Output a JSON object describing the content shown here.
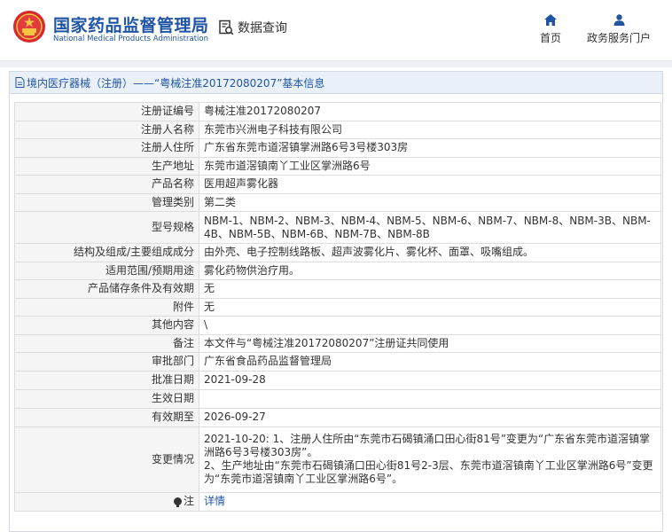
{
  "header": {
    "brand_cn": "国家药品监督管理局",
    "brand_en": "National Medical Products Administration",
    "query_label": "数据查询",
    "nav": [
      {
        "label": "首页",
        "icon": "home-icon"
      },
      {
        "label": "政务服务门户",
        "icon": "user-icon"
      }
    ]
  },
  "panel": {
    "title": "境内医疗器械（注册）——“粤械注准20172080207”基本信息"
  },
  "record": {
    "reg_no": {
      "label": "注册证编号",
      "value": "粤械注准20172080207"
    },
    "registrant": {
      "label": "注册人名称",
      "value": "东莞市兴洲电子科技有限公司"
    },
    "address": {
      "label": "注册人住所",
      "value": "广东省东莞市道滘镇掌洲路6号3号楼303房"
    },
    "prod_addr": {
      "label": "生产地址",
      "value": "东莞市道滘镇南丫工业区掌洲路6号"
    },
    "product": {
      "label": "产品名称",
      "value": "医用超声雾化器"
    },
    "category": {
      "label": "管理类别",
      "value": "第二类"
    },
    "models": {
      "label": "型号规格",
      "value": "NBM-1、NBM-2、NBM-3、NBM-4、NBM-5、NBM-6、NBM-7、NBM-8、NBM-3B、NBM-4B、NBM-5B、NBM-6B、NBM-7B、NBM-8B"
    },
    "structure": {
      "label": "结构及组成/主要组成成分",
      "value": "由外壳、电子控制线路板、超声波雾化片、雾化杯、面罩、吸嘴组成。"
    },
    "scope": {
      "label": "适用范围/预期用途",
      "value": "雾化药物供治疗用。"
    },
    "storage": {
      "label": "产品储存条件及有效期",
      "value": "无"
    },
    "attachment": {
      "label": "附件",
      "value": "无"
    },
    "other": {
      "label": "其他内容",
      "value": "\\"
    },
    "remark": {
      "label": "备注",
      "value": "本文件与“粤械注准20172080207”注册证共同使用"
    },
    "dept": {
      "label": "审批部门",
      "value": "广东省食品药品监督管理局"
    },
    "approve_date": {
      "label": "批准日期",
      "value": "2021-09-28"
    },
    "effective_date": {
      "label": "生效日期",
      "value": ""
    },
    "expiry": {
      "label": "有效期至",
      "value": "2026-09-27"
    },
    "changes": {
      "label": "变更情况",
      "value": "2021-10-20: 1、注册人住所由“东莞市石碣镇涌口田心街81号”变更为“广东省东莞市道滘镇掌洲路6号3号楼303房”。\n2、生产地址由“东莞市石碣镇涌口田心街81号2-3层、东莞市道滘镇南丫工业区掌洲路6号”变更为“东莞市道滘镇南丫工业区掌洲路6号”。"
    },
    "note": {
      "label": "注",
      "value": "详情"
    }
  }
}
